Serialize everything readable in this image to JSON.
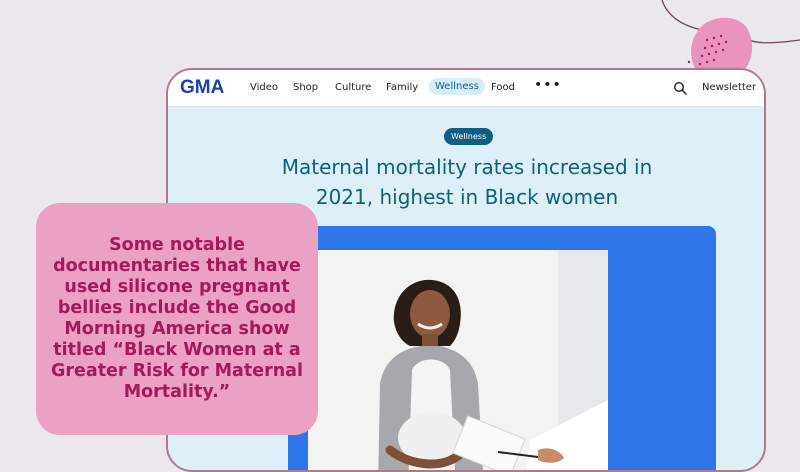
{
  "site": {
    "logo": "GMA",
    "nav_items": [
      "Video",
      "Shop",
      "Culture",
      "Family",
      "Wellness",
      "Food"
    ],
    "active_nav": "Wellness",
    "more_icon": "more-dots-icon",
    "search_icon": "search-icon",
    "newsletter_label": "Newsletter"
  },
  "article": {
    "category_badge": "Wellness",
    "headline_line1": "Maternal mortality rates increased in",
    "headline_line2": "2021, highest in Black women"
  },
  "caption": {
    "text": "Some notable documentaries that have used silicone pregnant bellies include the Good Morning America show titled “Black Women at a Greater Risk for Maternal Mortality.”"
  },
  "colors": {
    "page_background": "#ece6ee",
    "card_border": "#b07a8c",
    "caption_background": "#eba1c4",
    "caption_text": "#a3195b",
    "gma_blue": "#1c3fb8",
    "headline_teal": "#0f5f83",
    "article_background": "#ddf0f8",
    "photo_frame_blue": "#2f77e8"
  }
}
